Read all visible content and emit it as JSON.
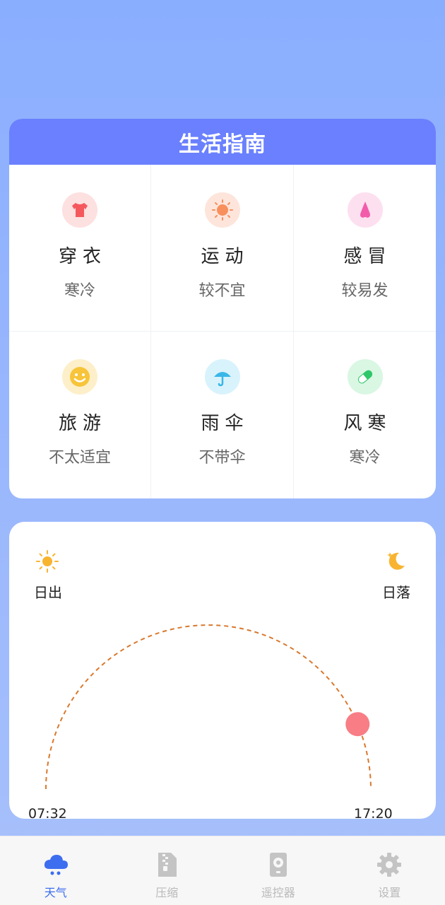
{
  "guide": {
    "title": "生活指南",
    "items": [
      {
        "title": "穿衣",
        "value": "寒冷",
        "icon": "shirt-icon",
        "bg": "#fde0e0",
        "color": "#f4585d"
      },
      {
        "title": "运动",
        "value": "较不宜",
        "icon": "sun-icon",
        "bg": "#fde5dc",
        "color": "#f7905c"
      },
      {
        "title": "感冒",
        "value": "较易发",
        "icon": "nose-icon",
        "bg": "#fde0f0",
        "color": "#f25cab"
      },
      {
        "title": "旅游",
        "value": "不太适宜",
        "icon": "smile-icon",
        "bg": "#fdefc9",
        "color": "#f7c43a"
      },
      {
        "title": "雨伞",
        "value": "不带伞",
        "icon": "umbrella-icon",
        "bg": "#d9f3fc",
        "color": "#39b7e8"
      },
      {
        "title": "风寒",
        "value": "寒冷",
        "icon": "pill-icon",
        "bg": "#d9f7e3",
        "color": "#2fc76a"
      }
    ]
  },
  "sun": {
    "sunrise_label": "日出",
    "sunset_label": "日落",
    "sunrise_time": "07:32",
    "sunset_time": "17:20",
    "progress": 0.87,
    "arc_color": "#d9782d",
    "dot_color": "#f87d85"
  },
  "tabs": [
    {
      "label": "天气",
      "icon": "cloud-icon",
      "active": true
    },
    {
      "label": "压缩",
      "icon": "zip-file-icon",
      "active": false
    },
    {
      "label": "遥控器",
      "icon": "remote-icon",
      "active": false
    },
    {
      "label": "设置",
      "icon": "gear-icon",
      "active": false
    }
  ],
  "colors": {
    "accent": "#3d6ef0",
    "header": "#6a80fe",
    "background": "#8aaefe"
  }
}
